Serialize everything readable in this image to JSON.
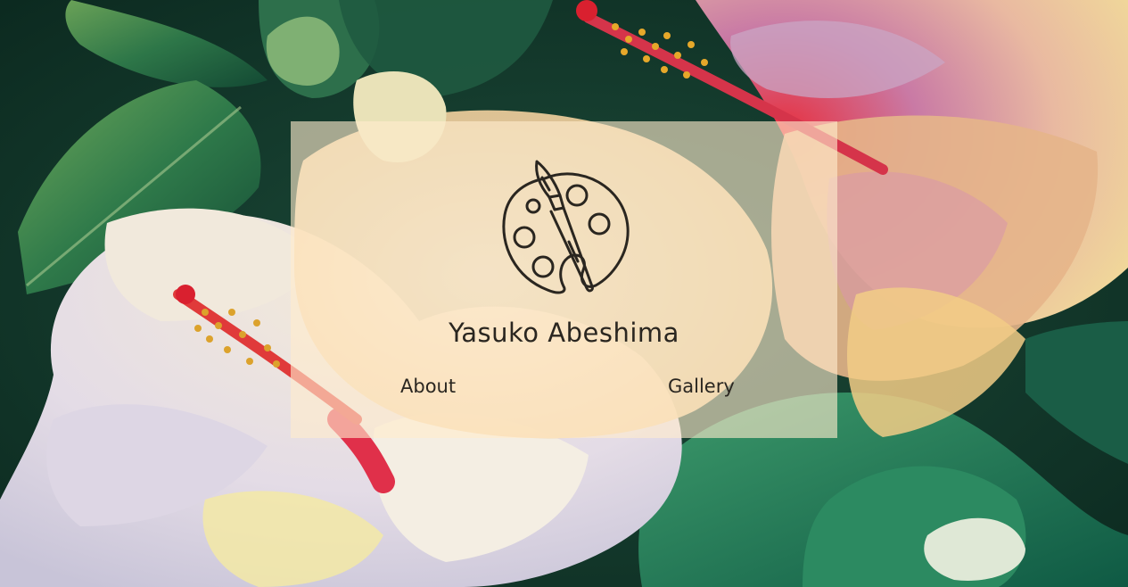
{
  "site": {
    "title": "Yasuko Abeshima"
  },
  "nav": {
    "items": [
      {
        "label": "About"
      },
      {
        "label": "Gallery"
      }
    ]
  },
  "logo": {
    "icon": "palette-brush-icon"
  },
  "background": {
    "description_icon": "hibiscus-painting"
  },
  "colors": {
    "card": "#ffecd0",
    "text": "#2a2620"
  }
}
